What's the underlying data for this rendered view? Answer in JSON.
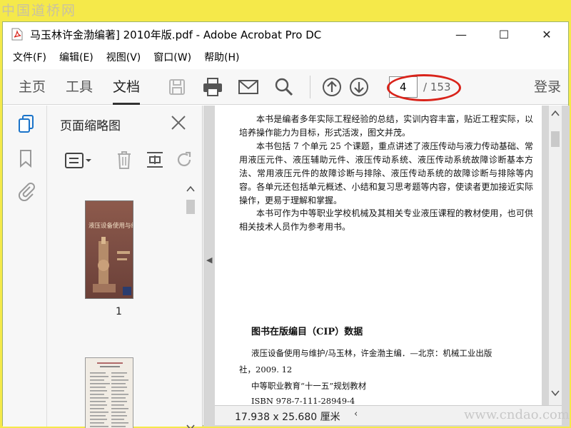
{
  "watermark": {
    "top": "中国道桥网",
    "bottom": "www.cndao.com"
  },
  "window": {
    "title": "马玉林许金渤编著] 2010年版.pdf - Adobe Acrobat Pro DC",
    "controls": {
      "minimize": "—",
      "maximize": "☐",
      "close": "✕"
    }
  },
  "menu": [
    "文件(F)",
    "编辑(E)",
    "视图(V)",
    "窗口(W)",
    "帮助(H)"
  ],
  "toolbar": {
    "tabs": [
      "主页",
      "工具",
      "文档"
    ],
    "active_tab": "文档",
    "icons": [
      "save-icon",
      "print-icon",
      "mail-icon",
      "search-icon",
      "page-up-icon",
      "page-down-icon"
    ],
    "page_current": "4",
    "page_total": "/ 153",
    "login": "登录",
    "highlight_color": "#d9231a"
  },
  "rail": {
    "icons": [
      "page-thumbnails-icon",
      "bookmark-icon",
      "attachment-icon"
    ]
  },
  "thumbnails_panel": {
    "title": "页面缩略图",
    "tools": [
      "options-menu-icon",
      "delete-icon",
      "crop-icon",
      "rotate-icon"
    ],
    "thumb1_title": "液压设备使用与维护",
    "thumb1_page_label": "1"
  },
  "document": {
    "paragraphs": [
      "本书是编者多年实际工程经验的总结，实训内容丰富，贴近工程实际，以培养操作能力为目标，形式活泼，图文并茂。",
      "本书包括 7 个单元 25 个课题，重点讲述了液压传动与液力传动基础、常用液压元件、液压辅助元件、液压传动系统、液压传动系统故障诊断基本方法、常用液压元件的故障诊断与排除、液压传动系统的故障诊断与排除等内容。各单元还包括单元概述、小结和复习思考题等内容，使读者更加接近实际操作，更易于理解和掌握。",
      "本书可作为中等职业学校机械及其相关专业液压课程的教材使用，也可供相关技术人员作为参考用书。"
    ],
    "cip_title": "图书在版编目（CIP）数据",
    "cip_lines": [
      "液压设备使用与维护/马玉林，许金渤主编．—北京：机械工业出版",
      "社，2009. 12",
      "中等职业教育“十一五”规划教材",
      "ISBN 978-7-111-28949-4"
    ],
    "dimensions": "17.938 x 25.680 厘米"
  }
}
